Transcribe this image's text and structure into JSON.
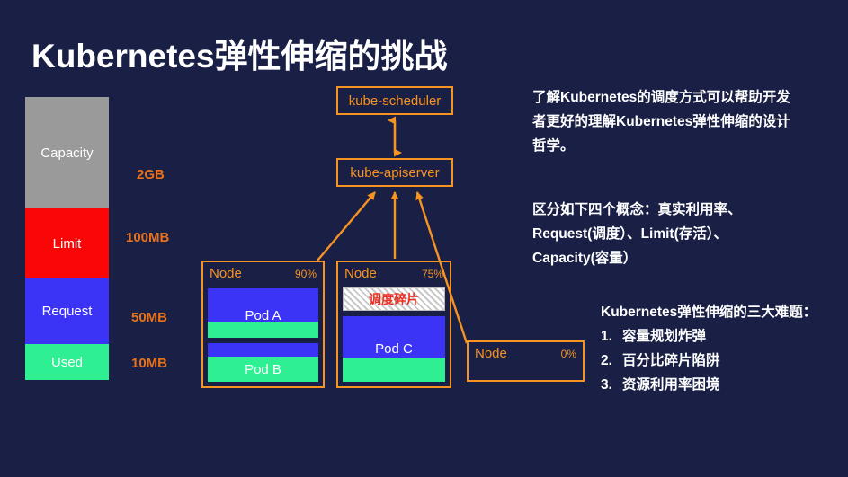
{
  "slide": {
    "title": "Kubernetes弹性伸缩的挑战",
    "background_color": "#1a1f45",
    "accent_color": "#f79320"
  },
  "resource_bar": {
    "segments": [
      {
        "label": "Capacity",
        "value": "2GB",
        "color": "#9a9a9a"
      },
      {
        "label": "Limit",
        "value": "100MB",
        "color": "#fb0606"
      },
      {
        "label": "Request",
        "value": "50MB",
        "color": "#3b33f5"
      },
      {
        "label": "Used",
        "value": "10MB",
        "color": "#2ef093"
      }
    ]
  },
  "control_plane": {
    "scheduler": "kube-scheduler",
    "apiserver": "kube-apiserver"
  },
  "nodes": [
    {
      "name": "Node",
      "utilization": "90%",
      "pods": [
        {
          "name": "Pod A"
        },
        {
          "name": "Pod B"
        }
      ]
    },
    {
      "name": "Node",
      "utilization": "75%",
      "fragment": "调度碎片",
      "pods": [
        {
          "name": "Pod C"
        }
      ]
    },
    {
      "name": "Node",
      "utilization": "0%",
      "pods": []
    }
  ],
  "notes": {
    "paragraph1": [
      "了解Kubernetes的调度方式可以帮助开发",
      "者更好的理解Kubernetes弹性伸缩的设计",
      "哲学。"
    ],
    "paragraph2": [
      "区分如下四个概念：真实利用率、",
      "Request(调度）、Limit(存活）、",
      "Capacity(容量）"
    ],
    "paragraph3_title": "Kubernetes弹性伸缩的三大难题：",
    "paragraph3_items": [
      {
        "num": "1.",
        "text": "容量规划炸弹"
      },
      {
        "num": "2.",
        "text": "百分比碎片陷阱"
      },
      {
        "num": "3.",
        "text": "资源利用率困境"
      }
    ]
  }
}
